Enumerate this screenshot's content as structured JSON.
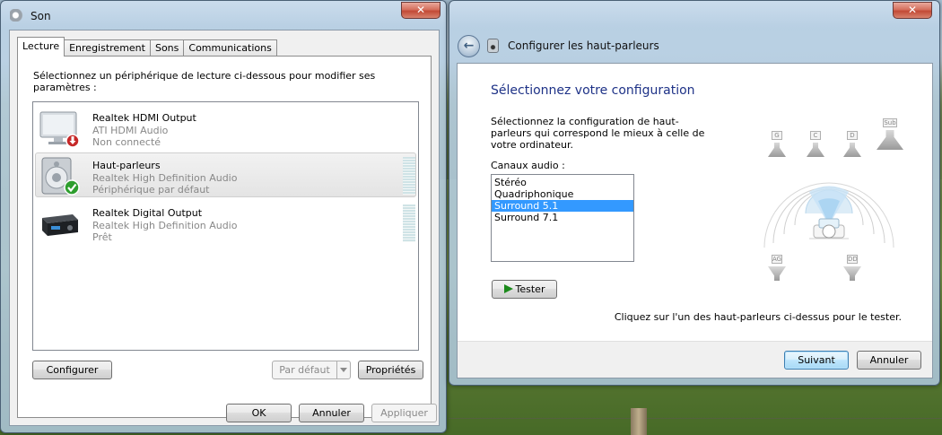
{
  "son": {
    "title": "Son",
    "tabs": [
      {
        "label": "Lecture",
        "active": true
      },
      {
        "label": "Enregistrement",
        "active": false
      },
      {
        "label": "Sons",
        "active": false
      },
      {
        "label": "Communications",
        "active": false
      }
    ],
    "instruction": "Sélectionnez un périphérique de lecture ci-dessous pour modifier ses paramètres :",
    "devices": [
      {
        "name": "Realtek HDMI Output",
        "driver": "ATI HDMI Audio",
        "status": "Non connecté",
        "icon": "monitor-icon",
        "badge": "disconnected-badge-icon"
      },
      {
        "name": "Haut-parleurs",
        "driver": "Realtek High Definition Audio",
        "status": "Périphérique par défaut",
        "icon": "speaker-icon",
        "badge": "default-check-icon"
      },
      {
        "name": "Realtek Digital Output",
        "driver": "Realtek High Definition Audio",
        "status": "Prêt",
        "icon": "receiver-icon",
        "badge": ""
      }
    ],
    "buttons": {
      "configure": "Configurer",
      "set_default": "Par défaut",
      "properties": "Propriétés",
      "ok": "OK",
      "cancel": "Annuler",
      "apply": "Appliquer"
    }
  },
  "setup": {
    "title": "Configurer les haut-parleurs",
    "heading": "Sélectionnez votre configuration",
    "description": "Sélectionnez la configuration de haut-parleurs qui correspond le mieux à celle de votre ordinateur.",
    "channels_label": "Canaux audio :",
    "channels": [
      "Stéréo",
      "Quadriphonique",
      "Surround 5.1",
      "Surround 7.1"
    ],
    "selected_channel": "Surround 5.1",
    "test_button": "Tester",
    "hint": "Cliquez sur l'un des haut-parleurs ci-dessus pour le tester.",
    "speakers": [
      "G",
      "C",
      "D",
      "Sub",
      "AG",
      "DD"
    ],
    "next_button": "Suivant",
    "cancel_button": "Annuler"
  },
  "colors": {
    "selection": "#3399ff",
    "heading": "#1e3287",
    "close_button": "#c24a36",
    "default_button_border": "#3c7fb1"
  }
}
